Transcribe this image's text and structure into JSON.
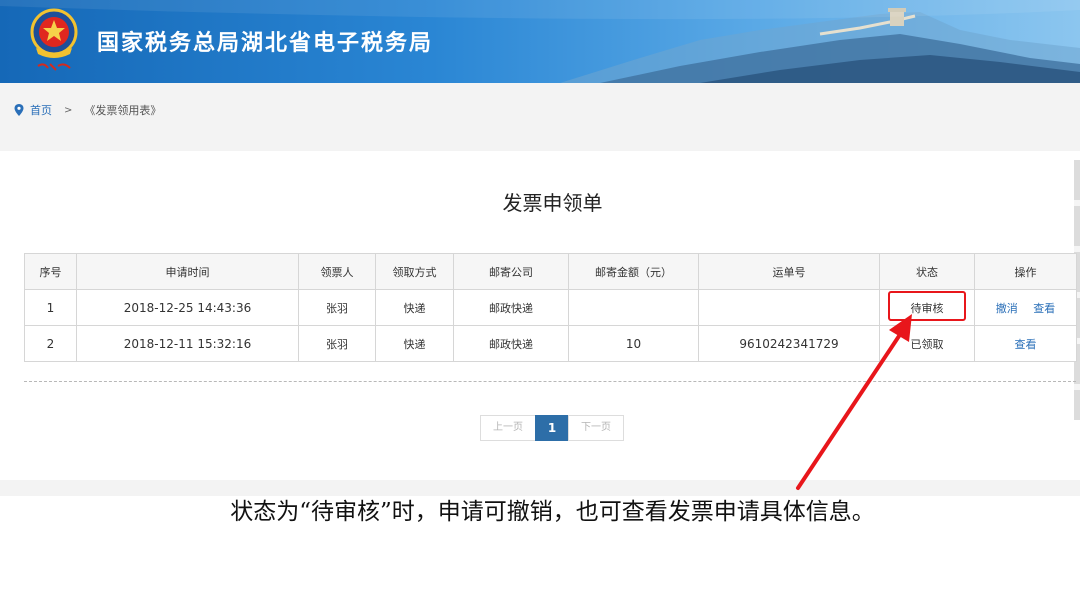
{
  "header": {
    "title": "国家税务总局湖北省电子税务局",
    "colors": {
      "banner_start": "#1568b7",
      "banner_end": "#8cc6ef"
    }
  },
  "breadcrumb": {
    "home": "首页",
    "separator": ">",
    "current": "《发票领用表》"
  },
  "form": {
    "title": "发票申领单",
    "columns": [
      "序号",
      "申请时间",
      "领票人",
      "领取方式",
      "邮寄公司",
      "邮寄金额（元）",
      "运单号",
      "状态",
      "操作"
    ],
    "rows": [
      {
        "index": "1",
        "time": "2018-12-25 14:43:36",
        "recipient": "张羽",
        "method": "快递",
        "company": "邮政快递",
        "amount": "",
        "waybill": "",
        "status": "待审核",
        "actions": [
          "撤消",
          "查看"
        ]
      },
      {
        "index": "2",
        "time": "2018-12-11 15:32:16",
        "recipient": "张羽",
        "method": "快递",
        "company": "邮政快递",
        "amount": "10",
        "waybill": "9610242341729",
        "status": "已领取",
        "actions": [
          "查看"
        ]
      }
    ]
  },
  "pager": {
    "prev": "上一页",
    "current": "1",
    "next": "下一页",
    "accent": "#2d6ea8"
  },
  "annotation": {
    "caption": "状态为“待审核”时，申请可撤销，也可查看发票申请具体信息。",
    "highlight_color": "#e8161b"
  }
}
